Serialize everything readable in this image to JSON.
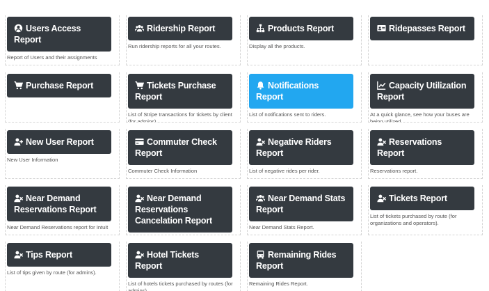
{
  "reports": [
    {
      "label": "Users Access Report",
      "icon": "user-circle-icon",
      "desc": "Report of Users and their assignments"
    },
    {
      "label": "Ridership Report",
      "icon": "users-icon",
      "desc": "Run ridership reports for all your routes."
    },
    {
      "label": "Products Report",
      "icon": "sitemap-icon",
      "desc": "Display all the products."
    },
    {
      "label": "Ridepasses Report",
      "icon": "id-card-icon",
      "desc": ""
    },
    {
      "label": "Purchase Report",
      "icon": "cart-icon",
      "desc": ""
    },
    {
      "label": "Tickets Purchase Report",
      "icon": "cart-icon",
      "desc": "List of Stripe transactions for tickets by client (for admins)"
    },
    {
      "label": "Notifications Report",
      "icon": "bell-icon",
      "desc": "List of notifications sent to riders."
    },
    {
      "label": "Capacity Utilization Report",
      "icon": "line-chart-icon",
      "desc": "At a quick glance, see how your buses are being utilized"
    },
    {
      "label": "New User Report",
      "icon": "user-plus-icon",
      "desc": "New User Information"
    },
    {
      "label": "Commuter Check Report",
      "icon": "credit-card-icon",
      "desc": "Commuter Check Information"
    },
    {
      "label": "Negative Riders Report",
      "icon": "user-times-icon",
      "desc": "List of negative rides per rider."
    },
    {
      "label": "Reservations Report",
      "icon": "user-times-icon",
      "desc": "Reservations report."
    },
    {
      "label": "Near Demand Reservations Report",
      "icon": "user-times-icon",
      "desc": "Near Demand Reservations report for Intuit"
    },
    {
      "label": "Near Demand Reservations Cancelation Report",
      "icon": "user-times-icon",
      "desc": ""
    },
    {
      "label": "Near Demand Stats Report",
      "icon": "users-icon",
      "desc": "Near Demand Stats Report."
    },
    {
      "label": "Tickets Report",
      "icon": "user-times-icon",
      "desc": "List of tickets purchased by route (for organizations and operators)."
    },
    {
      "label": "Tips Report",
      "icon": "user-times-icon",
      "desc": "List of tips given by route (for admins)."
    },
    {
      "label": "Hotel Tickets Report",
      "icon": "user-times-icon",
      "desc": "List of hotels tickets purchased by routes (for admins)"
    },
    {
      "label": "Remaining Rides Report",
      "icon": "bus-icon",
      "desc": "Remaining Rides Report."
    }
  ],
  "colors": {
    "button": "#343a40",
    "active": "#22a7f0"
  }
}
